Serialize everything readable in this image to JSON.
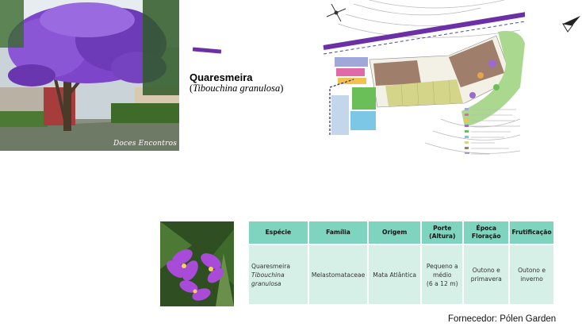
{
  "tree_photo": {
    "caption": "Doces Encontros"
  },
  "species": {
    "common_name": "Quaresmeira",
    "scientific_name": "Tibouchina granulosa"
  },
  "colors": {
    "accent": "#6b2fa6",
    "table_header": "#7fd4bf",
    "table_cell": "#d6f0e8"
  },
  "table": {
    "headers": [
      "Espécie",
      "Família",
      "Origem",
      "Porte",
      "(Altura)",
      "Época Floração",
      "Frutificação"
    ],
    "row": {
      "species_common": "Quaresmeira",
      "species_scientific_1": "Tibouchina",
      "species_scientific_2": "granulosa",
      "family": "Melastomataceae",
      "origin": "Mata Atlântica",
      "size_1": "Pequeno a",
      "size_2": "médio",
      "size_3": "(6 a 12 m)",
      "flowering_1": "Outono e",
      "flowering_2": "primavera",
      "fruiting_1": "Outono e",
      "fruiting_2": "inverno"
    }
  },
  "supplier": "Fornecedor: Pólen Garden"
}
